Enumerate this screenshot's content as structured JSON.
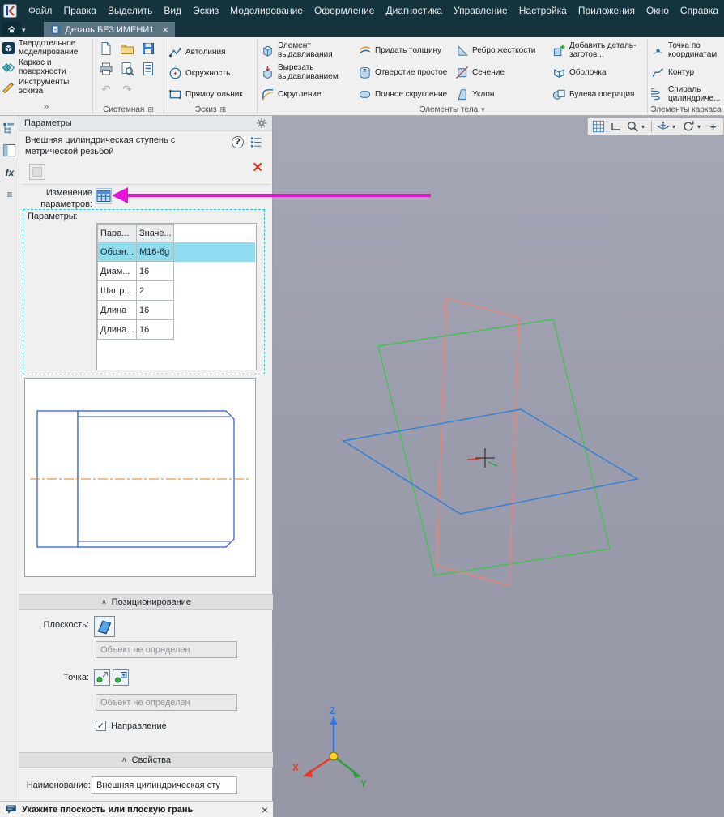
{
  "app": {
    "menu": [
      "Файл",
      "Правка",
      "Выделить",
      "Вид",
      "Эскиз",
      "Моделирование",
      "Оформление",
      "Диагностика",
      "Управление",
      "Настройка",
      "Приложения",
      "Окно",
      "Справка"
    ],
    "tab": {
      "title": "Деталь БЕЗ ИМЕНИ1"
    }
  },
  "icons": {
    "close": "×",
    "dropdown": "▾",
    "expand": "⊞",
    "collapse": "∧",
    "more": "»",
    "help": "?",
    "check": "✓",
    "fx": "fx",
    "menu": "≡",
    "undo": "↶",
    "redo": "↷",
    "plus": "+"
  },
  "toolbar": {
    "modes": [
      "Твердотельное моделирование",
      "Каркас и поверхности",
      "Инструменты эскиза"
    ],
    "system": {
      "label": "Системная"
    },
    "sketch": {
      "label": "Эскиз",
      "buttons": [
        "Автолиния",
        "Окружность",
        "Прямоугольник"
      ]
    },
    "body": {
      "label": "Элементы тела",
      "buttons": [
        "Элемент выдавливания",
        "Вырезать выдавливанием",
        "Скругление",
        "Придать толщину",
        "Отверстие простое",
        "Полное скругление",
        "Ребро жесткости",
        "Сечение",
        "Уклон",
        "Добавить деталь-заготов...",
        "Оболочка",
        "Булева операция"
      ]
    },
    "wireframe": {
      "label": "Элементы каркаса",
      "buttons": [
        "Точка по координатам",
        "Контур",
        "Спираль цилиндриче..."
      ]
    }
  },
  "panel": {
    "title": "Параметры",
    "feature": "Внешняя цилиндрическая ступень с метрической резьбой",
    "change_params": "Изменение параметров:",
    "group_label": "Параметры:",
    "table": {
      "headers": [
        "Пара...",
        "Значе..."
      ],
      "rows": [
        [
          "Обозн...",
          "M16-6g"
        ],
        [
          "Диам...",
          "16"
        ],
        [
          "Шаг р...",
          "2"
        ],
        [
          "Длина",
          "16"
        ],
        [
          "Длина...",
          "16"
        ]
      ]
    },
    "positioning": {
      "title": "Позиционирование",
      "plane_label": "Плоскость:",
      "plane_value": "Объект не определен",
      "point_label": "Точка:",
      "point_value": "Объект не определен",
      "direction": "Направление"
    },
    "properties": {
      "title": "Свойства",
      "name_label": "Наименование:",
      "name_value": "Внешняя цилиндрическая сту"
    }
  },
  "status": {
    "message": "Укажите плоскость или плоскую грань"
  },
  "viewport": {
    "gizmo": {
      "x": "X",
      "y": "Y",
      "z": "Z"
    }
  },
  "colors": {
    "selection_cyan": "#8edcee",
    "annotation_magenta": "#e812d6",
    "plane_red": "#ef8273",
    "plane_green": "#44c153",
    "plane_blue": "#2f80d8",
    "menubar": "#14333d"
  }
}
